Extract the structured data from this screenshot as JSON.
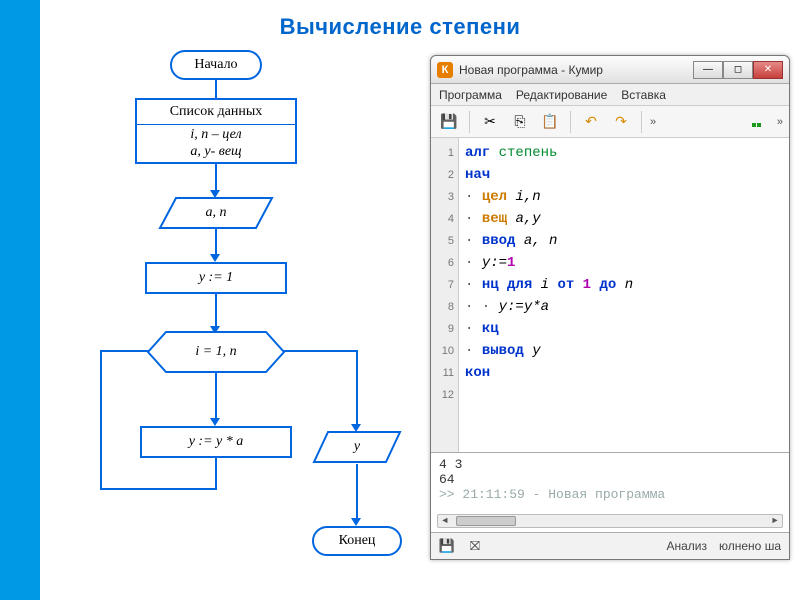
{
  "title": "Вычисление степени",
  "flow": {
    "start": "Начало",
    "data_header": "Список данных",
    "data_line1": "i, n – цел",
    "data_line2": "a, y- вещ",
    "input": "a, n",
    "init": "y := 1",
    "loop": "i = 1, n",
    "body": "y := y * a",
    "output": "y",
    "end": "Конец"
  },
  "window": {
    "title": "Новая программа - Кумир",
    "menu": {
      "program": "Программа",
      "edit": "Редактирование",
      "insert": "Вставка"
    },
    "more": "»",
    "status": {
      "analysis": "Анализ",
      "done": "юлнено ша"
    },
    "console": {
      "input": "4 3",
      "output": "64",
      "log": ">> 21:11:59 - Новая программа"
    },
    "code": {
      "l1_kw": "алг",
      "l1_name": "степень",
      "l2": "нач",
      "l3_ty": "цел",
      "l3_vars": "i,n",
      "l4_ty": "вещ",
      "l4_vars": "a,y",
      "l5_kw": "ввод",
      "l5_vars": "a, n",
      "l6": "y:=",
      "l6_lit": "1",
      "l7_a": "нц для",
      "l7_i": "i",
      "l7_b": "от",
      "l7_1": "1",
      "l7_c": "до",
      "l7_n": "n",
      "l8": "y:=y*a",
      "l9": "кц",
      "l10_kw": "вывод",
      "l10_v": "y",
      "l11": "кон"
    }
  }
}
